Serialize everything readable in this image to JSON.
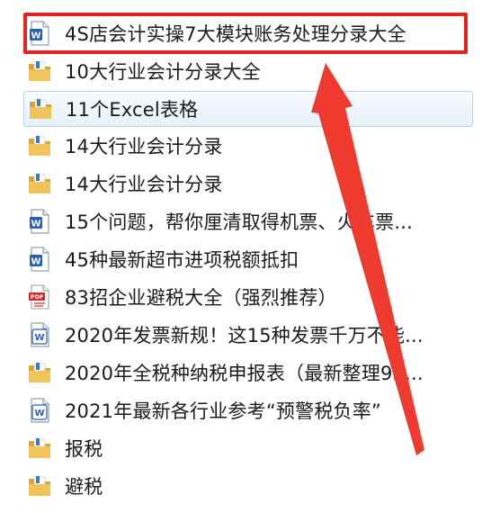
{
  "files": [
    {
      "name": "4S店会计实操7大模块账务处理分录大全",
      "icon": "word-doc-icon"
    },
    {
      "name": "10大行业会计分录大全",
      "icon": "folder-icon"
    },
    {
      "name": "11个Excel表格",
      "icon": "folder-icon"
    },
    {
      "name": "14大行业会计分录",
      "icon": "folder-icon"
    },
    {
      "name": "14大行业会计分录",
      "icon": "folder-icon"
    },
    {
      "name": "15个问题，帮你厘清取得机票、火车票...",
      "icon": "word-doc-icon"
    },
    {
      "name": "45种最新超市进项税额抵扣",
      "icon": "word-doc-icon"
    },
    {
      "name": "83招企业避税大全（强烈推荐）",
      "icon": "pdf-icon"
    },
    {
      "name": "2020年发票新规！这15种发票千万不能...",
      "icon": "wps-doc-icon"
    },
    {
      "name": "2020年全税种纳税申报表（最新整理92...",
      "icon": "folder-icon"
    },
    {
      "name": "2021年最新各行业参考“预警税负率”",
      "icon": "wps-doc-icon"
    },
    {
      "name": "报税",
      "icon": "folder-icon"
    },
    {
      "name": "避税",
      "icon": "folder-icon"
    }
  ],
  "colors": {
    "highlight": "#e3251f",
    "arrow": "#ef3b2f",
    "folder": "#e8b64a",
    "word": "#2b5fb4",
    "pdf": "#d9262c"
  }
}
